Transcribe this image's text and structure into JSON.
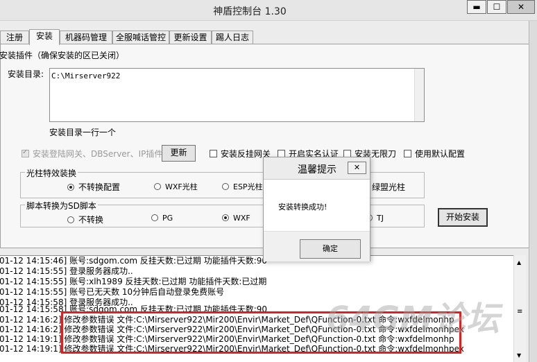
{
  "window": {
    "title": "神盾控制台 1.30",
    "minimize_label": "▬",
    "maximize_label": "☐",
    "close_label": "✕"
  },
  "tabs": [
    {
      "label": "注册"
    },
    {
      "label": "安装"
    },
    {
      "label": "机器码管理"
    },
    {
      "label": "全服喊话管控"
    },
    {
      "label": "更新设置"
    },
    {
      "label": "踢人日志"
    }
  ],
  "install": {
    "section_title": "安装插件（确保安装的区已关闭）",
    "dir_label": "安装目录:",
    "dir_value": "C:\\Mirserver922",
    "dir_hint": "安装目录一行一个",
    "cb_gateway": "安装登陆网关、DBServer、IP插件",
    "update_button": "更新",
    "cb_anti_gateway": "安装反挂网关",
    "cb_realname": "开启实名认证",
    "cb_unlimited": "安装无限刀",
    "cb_default_cfg": "使用默认配置",
    "light_group": "光柱特效装换",
    "light_options": [
      "不转换配置",
      "WXF光柱",
      "ESP光柱",
      "绿盟光柱"
    ],
    "script_group": "脚本转换为SD脚本",
    "script_options": [
      "不转换",
      "PG",
      "WXF",
      "TJ"
    ],
    "start_button": "开始安装"
  },
  "dialog": {
    "title": "温馨提示",
    "close_label": "✕",
    "message": "安装转换成功!",
    "ok_button": "确定"
  },
  "log": {
    "lines": [
      "01-12 14:15:46] 账号:sdgom.com  反挂天数:已过期  功能插件天数:90",
      "01-12 14:15:55] 登录服务器成功..",
      "01-12 14:15:55] 账号:xlh1989  反挂天数:已过期  功能插件天数:已过期",
      "01-12 14:15:55] 账号已无天数 10分钟后自动登录免费账号",
      "01-12 14:15:58] 登录服务器成功..",
      "01-12 14:15:58] 账号:sdgom.com  反挂天数:已过期  功能插件天数:90",
      "01-12 14:16:2] 修改参数错误  文件:C:\\Mirserver922\\Mir200\\Envir\\Market_Def\\QFunction-0.txt 命令:wxfdelmonhp",
      "01-12 14:16:2] 修改参数错误  文件:C:\\Mirserver922\\Mir200\\Envir\\Market_Def\\QFunction-0.txt 命令:wxfdelmonhpex",
      "01-12 14:19:1] 修改参数错误  文件:C:\\Mirserver922\\Mir200\\Envir\\Market_Def\\QFunction-0.txt 命令:wxfdelmonhp",
      "01-12 14:19:1] 修改参数错误  文件:C:\\Mirserver922\\Mir200\\Envir\\Market_Def\\QFunction-0.txt 命令:wxfdelmonhpex"
    ]
  },
  "watermark": "64GM论坛"
}
